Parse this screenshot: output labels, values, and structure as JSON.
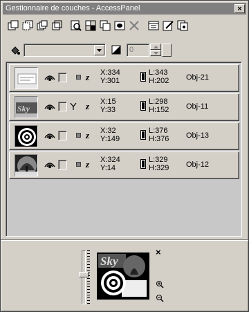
{
  "window": {
    "title": "Gestionnaire de couches - AccessPanel",
    "close_glyph": "×"
  },
  "toolbar": {
    "buttons": [
      {
        "name": "bring-to-front-icon"
      },
      {
        "name": "send-to-back-icon"
      },
      {
        "name": "bring-forward-icon"
      },
      {
        "name": "send-backward-icon"
      },
      {
        "name": "zoom-layer-icon"
      },
      {
        "name": "group-icon"
      },
      {
        "name": "duplicate-icon"
      },
      {
        "name": "mask-icon"
      },
      {
        "name": "delete-icon"
      },
      {
        "name": "properties-icon"
      },
      {
        "name": "edit-icon"
      },
      {
        "name": "copy-layers-icon"
      }
    ]
  },
  "controls": {
    "blend_mode_value": "",
    "opacity_value": "0"
  },
  "layers": [
    {
      "x": "X:334",
      "y": "Y:301",
      "l": "L:343",
      "h": "H:202",
      "name": "Obj-21",
      "thumb": "text-thumbnail",
      "link": false
    },
    {
      "x": "X:15",
      "y": "Y:33",
      "l": "L:298",
      "h": "H:152",
      "name": "Obj-11",
      "thumb": "sky-thumbnail",
      "link": true
    },
    {
      "x": "X:32",
      "y": "Y:149",
      "l": "L:376",
      "h": "H:376",
      "name": "Obj-13",
      "thumb": "target-thumbnail",
      "link": false
    },
    {
      "x": "X:324",
      "y": "Y:14",
      "l": "L:329",
      "h": "H:329",
      "name": "Obj-12",
      "thumb": "tree-thumbnail",
      "link": false
    }
  ],
  "navigator": {
    "close_glyph": "×",
    "preview_text": "Sky"
  },
  "colors": {
    "title_bg": "#808080",
    "face": "#d4d0c8",
    "list_bg": "#c8c8c8"
  }
}
